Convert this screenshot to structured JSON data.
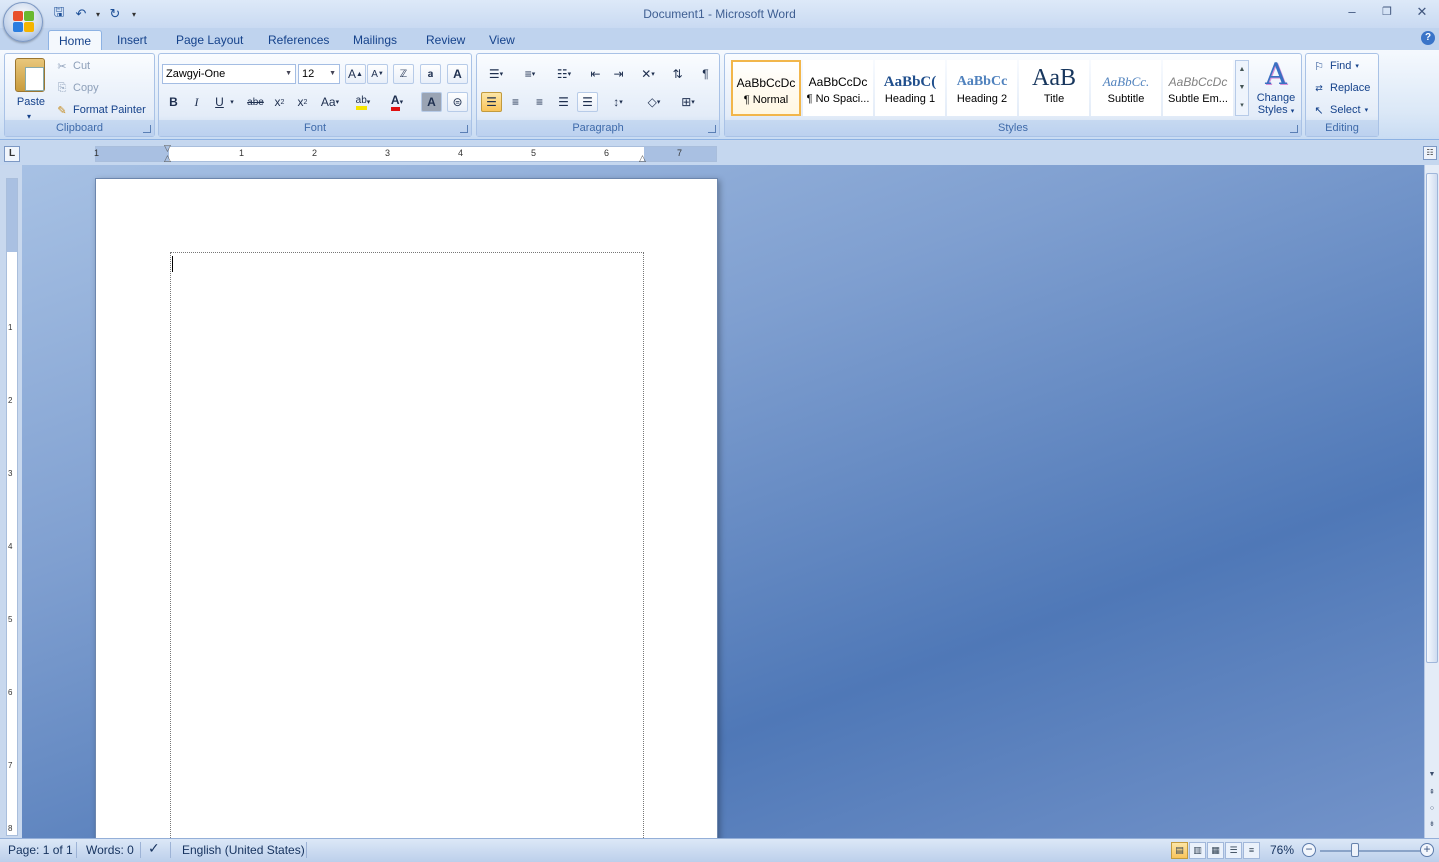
{
  "window": {
    "title": "Document1 - Microsoft Word",
    "minimize_icon": "minimize-icon",
    "maximize_icon": "restore-icon",
    "close_icon": "close-icon"
  },
  "qat": {
    "items": [
      "save-icon",
      "undo-icon",
      "redo-icon",
      "customize-icon"
    ]
  },
  "tabs": [
    "Home",
    "Insert",
    "Page Layout",
    "References",
    "Mailings",
    "Review",
    "View"
  ],
  "clipboard": {
    "label": "Clipboard",
    "paste": "Paste",
    "cut": "Cut",
    "copy": "Copy",
    "format_painter": "Format Painter"
  },
  "font": {
    "label": "Font",
    "name": "Zawgyi-One",
    "size": "12",
    "bold": "B",
    "italic": "I",
    "underline": "U",
    "strike": "abe",
    "change_case": "Aa",
    "grow": "A",
    "shrink": "A"
  },
  "paragraph": {
    "label": "Paragraph",
    "show_marks": "¶"
  },
  "styles": {
    "label": "Styles",
    "items": [
      {
        "sample": "AaBbCcDc",
        "name": "¶ Normal"
      },
      {
        "sample": "AaBbCcDc",
        "name": "¶ No Spaci..."
      },
      {
        "sample": "AaBbC(",
        "name": "Heading 1"
      },
      {
        "sample": "AaBbCc",
        "name": "Heading 2"
      },
      {
        "sample": "AaB",
        "name": "Title"
      },
      {
        "sample": "AaBbCc.",
        "name": "Subtitle"
      },
      {
        "sample": "AaBbCcDc",
        "name": "Subtle Em..."
      }
    ],
    "change_styles_line1": "Change",
    "change_styles_line2": "Styles"
  },
  "editing": {
    "label": "Editing",
    "find": "Find",
    "replace": "Replace",
    "select": "Select"
  },
  "ruler": {
    "numbers": [
      "1",
      "1",
      "2",
      "3",
      "4",
      "5",
      "6",
      "7"
    ],
    "vnumbers": [
      "1",
      "2",
      "3",
      "4",
      "5",
      "6",
      "7",
      "8"
    ],
    "corner": "L"
  },
  "status": {
    "page": "Page: 1 of 1",
    "words": "Words: 0",
    "language": "English (United States)",
    "zoom": "76%",
    "zoom_minus": "−",
    "zoom_plus": "+",
    "zoom_value": 76
  },
  "colors": {
    "accent": "#15428b",
    "highlight": "#f5e400",
    "font_color": "#e01010"
  }
}
